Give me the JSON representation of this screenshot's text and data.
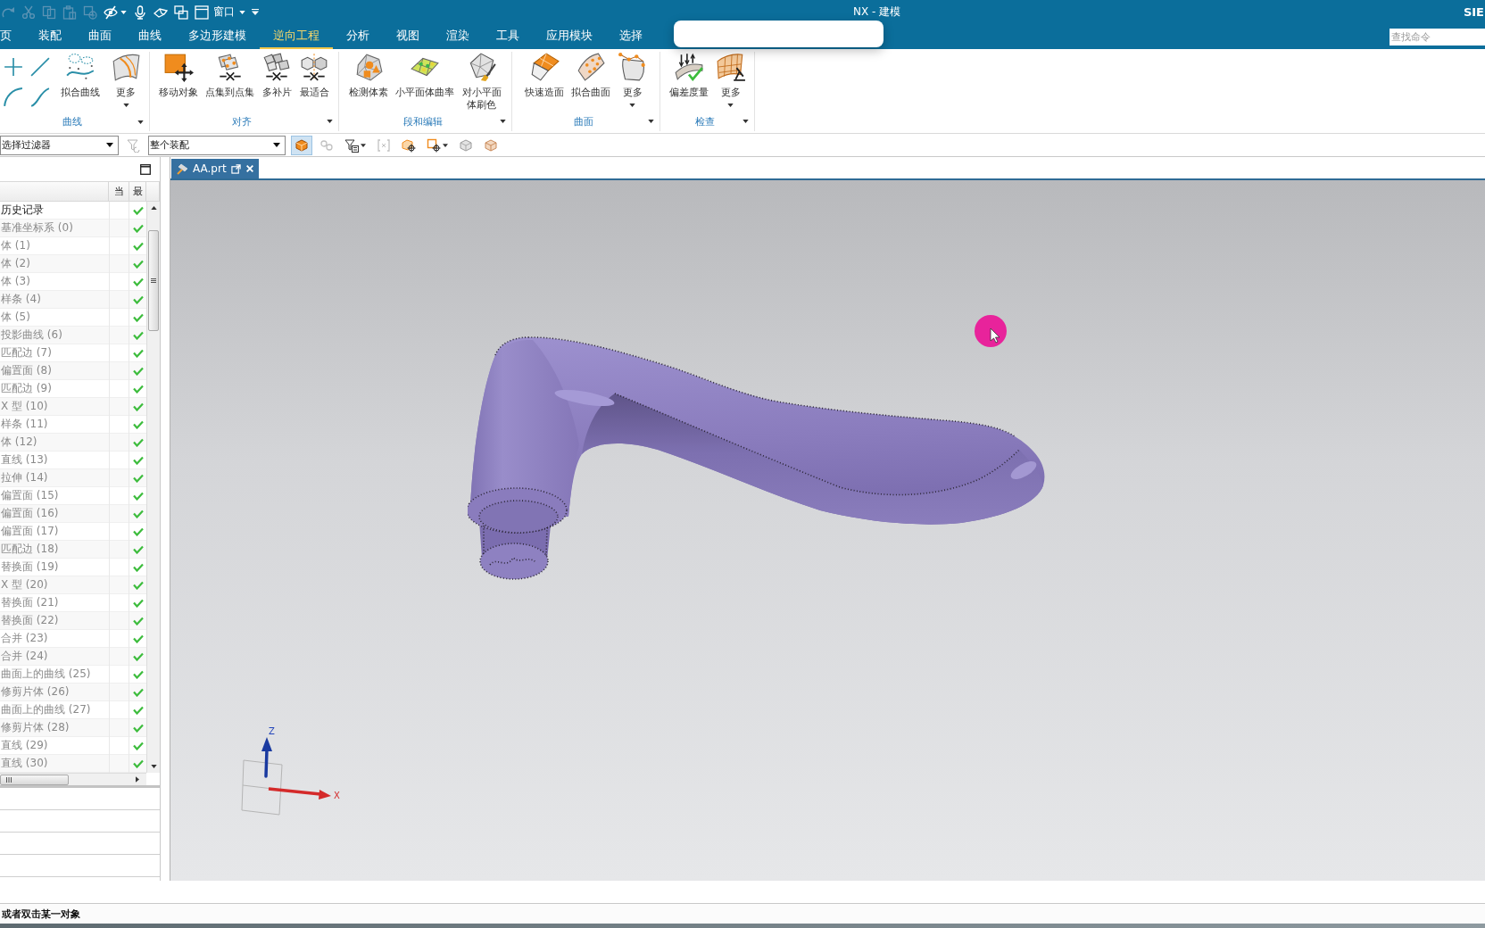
{
  "window": {
    "title": "NX - 建模",
    "brand": "SIE"
  },
  "quick_access": {
    "tools": [
      {
        "disabled": true,
        "menu": false
      },
      {
        "disabled": true,
        "menu": false
      },
      {
        "disabled": true,
        "menu": false
      },
      {
        "disabled": true,
        "menu": false
      },
      {
        "disabled": true,
        "menu": false
      },
      {
        "disabled": false,
        "menu": true
      },
      {
        "disabled": false,
        "menu": false
      },
      {
        "disabled": false,
        "menu": false
      },
      {
        "disabled": false,
        "menu": false
      }
    ],
    "window_menu": "窗口"
  },
  "ribbon_tabs": [
    {
      "label": "页",
      "selected": false
    },
    {
      "label": "装配",
      "selected": false
    },
    {
      "label": "曲面",
      "selected": false
    },
    {
      "label": "曲线",
      "selected": false
    },
    {
      "label": "多边形建模",
      "selected": false
    },
    {
      "label": "逆向工程",
      "selected": true
    },
    {
      "label": "分析",
      "selected": false
    },
    {
      "label": "视图",
      "selected": false
    },
    {
      "label": "渲染",
      "selected": false
    },
    {
      "label": "工具",
      "selected": false
    },
    {
      "label": "应用模块",
      "selected": false
    },
    {
      "label": "选择",
      "selected": false
    }
  ],
  "command_search": {
    "placeholder": "查找命令"
  },
  "ribbon_groups": [
    {
      "label": "曲线",
      "commands": [
        {
          "kind": "small"
        },
        {
          "kind": "small"
        },
        {
          "kind": "small"
        },
        {
          "kind": "small"
        },
        {
          "kind": "large",
          "label": "拟合曲线",
          "menu": false
        },
        {
          "kind": "large",
          "label": "更多",
          "menu": true
        }
      ]
    },
    {
      "label": "对齐",
      "commands": [
        {
          "kind": "large",
          "label": "移动对象",
          "menu": false
        },
        {
          "kind": "large",
          "label": "点集到点集",
          "menu": false
        },
        {
          "kind": "large",
          "label": "多补片",
          "menu": false
        },
        {
          "kind": "large",
          "label": "最适合",
          "menu": false
        }
      ]
    },
    {
      "label": "段和编辑",
      "commands": [
        {
          "kind": "large",
          "label": "检测体素",
          "menu": false
        },
        {
          "kind": "large",
          "label": "小平面体曲率",
          "menu": false
        },
        {
          "kind": "large",
          "label": "对小平面体刷色",
          "menu": false
        }
      ]
    },
    {
      "label": "曲面",
      "commands": [
        {
          "kind": "large",
          "label": "快速造面",
          "menu": false
        },
        {
          "kind": "large",
          "label": "拟合曲面",
          "menu": false
        },
        {
          "kind": "large",
          "label": "更多",
          "menu": true
        }
      ]
    },
    {
      "label": "检查",
      "commands": [
        {
          "kind": "large",
          "label": "偏差度量",
          "menu": false
        },
        {
          "kind": "large",
          "label": "更多",
          "menu": true
        }
      ]
    }
  ],
  "selection_bar": {
    "filter": "选择过滤器",
    "filter_reset": {
      "disabled": true
    },
    "scope": "整个装配",
    "tools": [
      {
        "selected": true,
        "disabled": false,
        "menu": false
      },
      {
        "selected": false,
        "disabled": true,
        "menu": false
      },
      {
        "selected": false,
        "disabled": false,
        "menu": true
      },
      {
        "selected": false,
        "disabled": true,
        "menu": false
      },
      {
        "selected": false,
        "disabled": false,
        "menu": false
      },
      {
        "selected": false,
        "disabled": false,
        "menu": true
      },
      {
        "selected": false,
        "disabled": false,
        "menu": false
      },
      {
        "selected": false,
        "disabled": false,
        "menu": false
      }
    ]
  },
  "navigator": {
    "columns": [
      "当",
      "最"
    ],
    "rows": [
      {
        "kind": "group",
        "label": "历史记录",
        "up_to_date": true
      },
      {
        "kind": "feature",
        "label": "基准坐标系 (0)",
        "up_to_date": true
      },
      {
        "kind": "feature",
        "label": "体 (1)",
        "up_to_date": true
      },
      {
        "kind": "feature",
        "label": "体 (2)",
        "up_to_date": true
      },
      {
        "kind": "feature",
        "label": "体 (3)",
        "up_to_date": true
      },
      {
        "kind": "feature",
        "label": "样条 (4)",
        "up_to_date": true
      },
      {
        "kind": "feature",
        "label": "体 (5)",
        "up_to_date": true
      },
      {
        "kind": "feature",
        "label": "投影曲线 (6)",
        "up_to_date": true
      },
      {
        "kind": "feature",
        "label": "匹配边 (7)",
        "up_to_date": true
      },
      {
        "kind": "feature",
        "label": "偏置面 (8)",
        "up_to_date": true
      },
      {
        "kind": "feature",
        "label": "匹配边 (9)",
        "up_to_date": true
      },
      {
        "kind": "feature",
        "label": "X 型 (10)",
        "up_to_date": true
      },
      {
        "kind": "feature",
        "label": "样条 (11)",
        "up_to_date": true
      },
      {
        "kind": "feature",
        "label": "体 (12)",
        "up_to_date": true
      },
      {
        "kind": "feature",
        "label": "直线 (13)",
        "up_to_date": true
      },
      {
        "kind": "feature",
        "label": "拉伸 (14)",
        "up_to_date": true
      },
      {
        "kind": "feature",
        "label": "偏置面 (15)",
        "up_to_date": true
      },
      {
        "kind": "feature",
        "label": "偏置面 (16)",
        "up_to_date": true
      },
      {
        "kind": "feature",
        "label": "偏置面 (17)",
        "up_to_date": true
      },
      {
        "kind": "feature",
        "label": "匹配边 (18)",
        "up_to_date": true
      },
      {
        "kind": "feature",
        "label": "替换面 (19)",
        "up_to_date": true
      },
      {
        "kind": "feature",
        "label": "X 型 (20)",
        "up_to_date": true
      },
      {
        "kind": "feature",
        "label": "替换面 (21)",
        "up_to_date": true
      },
      {
        "kind": "feature",
        "label": "替换面 (22)",
        "up_to_date": true
      },
      {
        "kind": "feature",
        "label": "合并 (23)",
        "up_to_date": true
      },
      {
        "kind": "feature",
        "label": "合并 (24)",
        "up_to_date": true
      },
      {
        "kind": "feature",
        "label": "曲面上的曲线 (25)",
        "up_to_date": true
      },
      {
        "kind": "feature",
        "label": "修剪片体 (26)",
        "up_to_date": true
      },
      {
        "kind": "feature",
        "label": "曲面上的曲线 (27)",
        "up_to_date": true
      },
      {
        "kind": "feature",
        "label": "修剪片体 (28)",
        "up_to_date": true
      },
      {
        "kind": "feature",
        "label": "直线 (29)",
        "up_to_date": true
      },
      {
        "kind": "feature",
        "label": "直线 (30)",
        "up_to_date": true
      }
    ]
  },
  "document_tab": {
    "label": "AA.prt"
  },
  "viewport": {
    "triad": {
      "z_label": "Z",
      "x_label": "X"
    }
  },
  "status_bar": {
    "prompt": "或者双击某一对象"
  }
}
